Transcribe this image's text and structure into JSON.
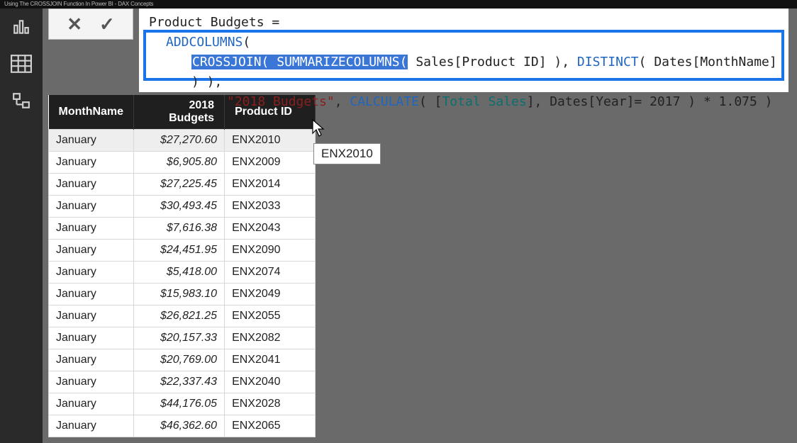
{
  "title_bar": "Using The CROSSJOIN Function In Power BI - DAX Concepts",
  "formula": {
    "header": "Product Budgets =",
    "addcolumns": "ADDCOLUMNS",
    "open": "(",
    "crossjoin": "CROSSJOIN",
    "summarize": "SUMMARIZECOLUMNS",
    "sales_col": "Sales[Product ID]",
    "distinct": "DISTINCT",
    "dates_monthname": "Dates[MonthName]",
    "budgets_label": "\"2018 Budgets\"",
    "calculate": "CALCULATE",
    "total_sales": "Total Sales",
    "dates_year": "Dates[Year]",
    "eq2017": "= 2017",
    "times": " * 1.075 )"
  },
  "table": {
    "headers": {
      "month": "MonthName",
      "budget": "2018 Budgets",
      "pid": "Product ID"
    },
    "rows": [
      {
        "month": "January",
        "budget": "$27,270.60",
        "pid": "ENX2010",
        "selected": true
      },
      {
        "month": "January",
        "budget": "$6,905.80",
        "pid": "ENX2009"
      },
      {
        "month": "January",
        "budget": "$27,225.45",
        "pid": "ENX2014"
      },
      {
        "month": "January",
        "budget": "$30,493.45",
        "pid": "ENX2033"
      },
      {
        "month": "January",
        "budget": "$7,616.38",
        "pid": "ENX2043"
      },
      {
        "month": "January",
        "budget": "$24,451.95",
        "pid": "ENX2090"
      },
      {
        "month": "January",
        "budget": "$5,418.00",
        "pid": "ENX2074"
      },
      {
        "month": "January",
        "budget": "$15,983.10",
        "pid": "ENX2049"
      },
      {
        "month": "January",
        "budget": "$26,821.25",
        "pid": "ENX2055"
      },
      {
        "month": "January",
        "budget": "$20,157.33",
        "pid": "ENX2082"
      },
      {
        "month": "January",
        "budget": "$20,769.00",
        "pid": "ENX2041"
      },
      {
        "month": "January",
        "budget": "$22,337.43",
        "pid": "ENX2040"
      },
      {
        "month": "January",
        "budget": "$44,176.05",
        "pid": "ENX2028"
      },
      {
        "month": "January",
        "budget": "$46,362.60",
        "pid": "ENX2065"
      }
    ]
  },
  "tooltip": "ENX2010",
  "buttons": {
    "cancel": "✕",
    "commit": "✓"
  }
}
